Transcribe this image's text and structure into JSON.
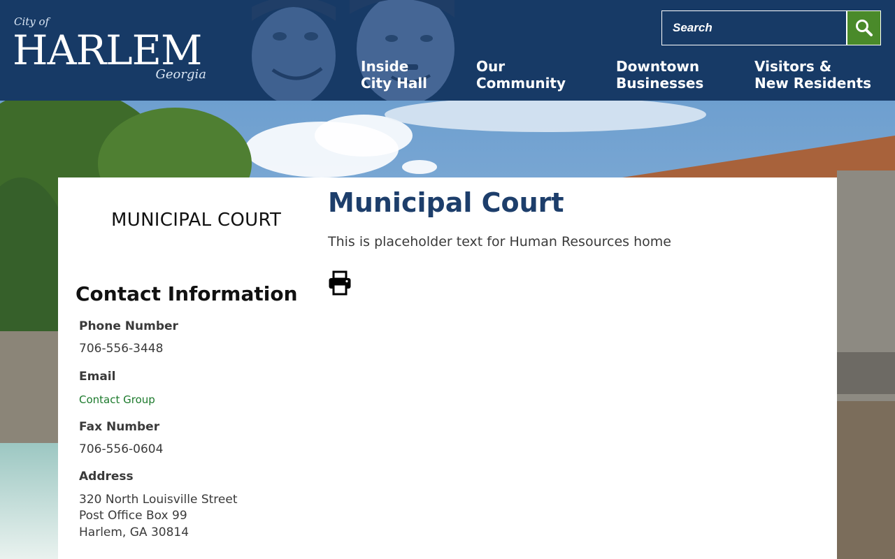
{
  "header": {
    "logo": {
      "city_of": "City of",
      "name": "HARLEM",
      "state": "Georgia"
    },
    "search": {
      "placeholder": "Search"
    },
    "nav": [
      {
        "line1": "Inside",
        "line2": "City Hall"
      },
      {
        "line1": "Our",
        "line2": "Community"
      },
      {
        "line1": "Downtown",
        "line2": "Businesses"
      },
      {
        "line1": "Visitors &",
        "line2": "New Residents"
      }
    ]
  },
  "sidebar": {
    "section_title": "MUNICIPAL COURT",
    "contact_heading": "Contact Information",
    "phone_label": "Phone Number",
    "phone_value": "706-556-3448",
    "email_label": "Email",
    "email_link": "Contact Group",
    "fax_label": "Fax Number",
    "fax_value": "706-556-0604",
    "address_label": "Address",
    "address_line1": "320 North Louisville Street",
    "address_line2": "Post Office Box 99",
    "address_line3": "Harlem, GA 30814"
  },
  "main": {
    "title": "Municipal Court",
    "body": "This is placeholder text for Human Resources home"
  },
  "colors": {
    "header_bg": "#173a66",
    "search_button": "#4a8a2a",
    "title_color": "#1d3e6b",
    "link_color": "#1c7a2c"
  },
  "icons": {
    "search": "magnifier-icon",
    "print": "printer-icon"
  }
}
